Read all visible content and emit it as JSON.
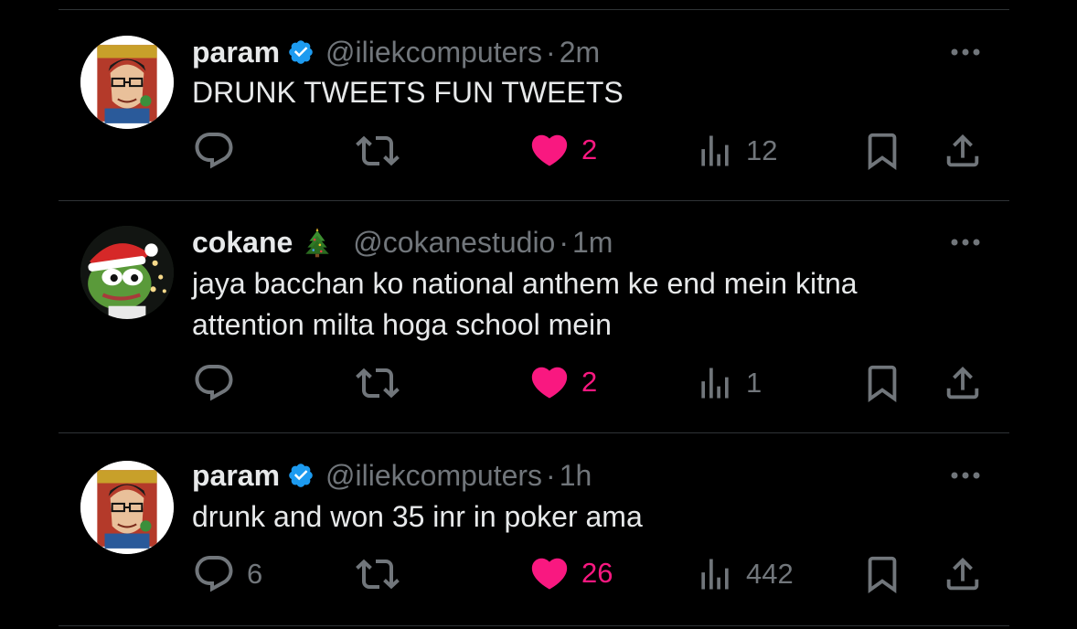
{
  "tweets": [
    {
      "name": "param",
      "verified": true,
      "handle": "@iliekcomputers",
      "dot": "·",
      "time": "2m",
      "text_lines": [
        "DRUNK TWEETS FUN TWEETS"
      ],
      "replies": "",
      "retweets": "",
      "likes": "2",
      "liked": true,
      "views": "12"
    },
    {
      "name": "cokane",
      "verified": false,
      "name_emoji": "christmas-tree-icon",
      "handle": "@cokanestudio",
      "dot": "·",
      "time": "1m",
      "text_lines": [
        "jaya bacchan ko national anthem ke end mein kitna",
        "attention milta hoga school mein"
      ],
      "replies": "",
      "retweets": "",
      "likes": "2",
      "liked": true,
      "views": "1"
    },
    {
      "name": "param",
      "verified": true,
      "handle": "@iliekcomputers",
      "dot": "·",
      "time": "1h",
      "text_lines": [
        "drunk and won 35 inr in poker ama"
      ],
      "replies": "6",
      "retweets": "",
      "likes": "26",
      "liked": true,
      "views": "442"
    }
  ],
  "colors": {
    "background": "#000000",
    "text": "#e7e9ea",
    "muted": "#71767b",
    "like": "#f91880",
    "verified": "#1d9bf0",
    "divider": "#2f3336"
  },
  "icons": [
    "reply-icon",
    "retweet-icon",
    "heart-icon",
    "views-icon",
    "bookmark-icon",
    "share-icon",
    "more-icon",
    "verified-icon"
  ]
}
